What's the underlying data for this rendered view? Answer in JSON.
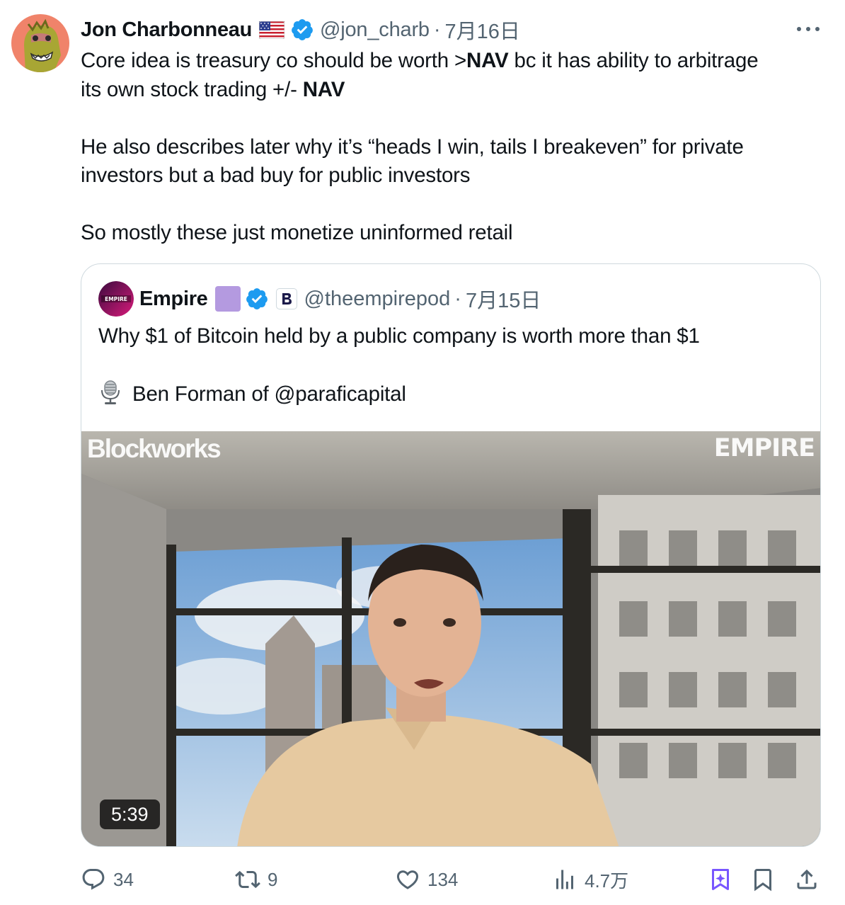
{
  "author": {
    "name": "Jon Charbonneau",
    "flag": "us-flag-icon",
    "handle": "@jon_charb",
    "separator": "·",
    "time": "7月16日"
  },
  "tweet": {
    "line1_a": "Core idea is treasury co should be worth >",
    "line1_b": "NAV",
    "line1_c": " bc it has ability to arbitrage",
    "line2_a": "its own stock trading +/- ",
    "line2_b": "NAV",
    "para2": "He also describes later why it’s “heads I win, tails I breakeven” for private investors but a bad buy for public investors",
    "para3": "So mostly these just monetize uninformed retail"
  },
  "quote": {
    "name": "Empire",
    "handle": "@theempirepod",
    "separator": "·",
    "time": "7月15日",
    "text1": "Why $1 of Bitcoin held by a public company is worth more than $1",
    "text2": "Ben Forman of @paraficapital",
    "video": {
      "watermark_left": "Blockworks",
      "watermark_right": "EMPIRE",
      "duration": "5:39"
    }
  },
  "actions": {
    "replies": "34",
    "reposts": "9",
    "likes": "134",
    "views": "4.7万"
  },
  "colors": {
    "accent": "#1d9bf0",
    "muted": "#536471",
    "grok": "#7856ff",
    "empire_badge": "#b49ae0"
  }
}
